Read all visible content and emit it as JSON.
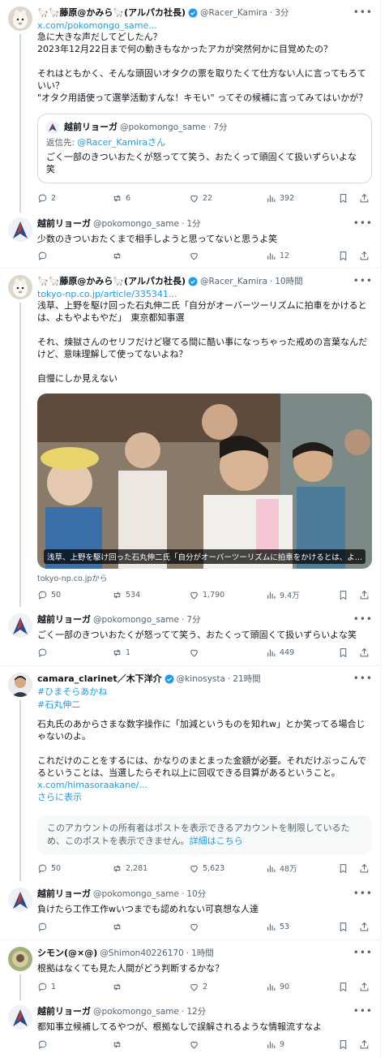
{
  "icons": {
    "reply": "reply-icon",
    "repost": "repost-icon",
    "like": "like-icon",
    "views": "views-icon",
    "bookmark": "bookmark-icon",
    "share": "share-icon",
    "more": "more-icon",
    "verified": "verified-badge-icon"
  },
  "colors": {
    "link": "#1d9bf0",
    "muted": "#536471",
    "verified": "#1d9bf0",
    "border": "#cfd9de"
  },
  "posts": [
    {
      "name": "🦙🦙藤原@かみら🦙(アルパカ社長)",
      "handle": "@Racer_Kamira",
      "time": "3分",
      "link": "x.com/pokomongo_same...",
      "text": "急に大きな声だしてどしたん？\n2023年12月22日まで何の動きもなかったアカが突然何かに目覚めたの？\n\nそれはともかく、そんな頭固いオタクの票を取りたくて仕方ない人に言ってもろていい？\n\"オタク用語使って選挙活動すんな！キモい\" ってその候補に言ってみてはいかが？",
      "quote": {
        "name": "越前リョーガ",
        "handle": "@pokomongo_same",
        "time": "7分",
        "reply_to_prefix": "返信先: ",
        "reply_to": "@Racer_Kamiraさん",
        "text": "ごく一部のきついおたくが怒ってて笑う、おたくって頭固くて扱いずらいよな笑"
      },
      "replies": "2",
      "reposts": "6",
      "likes": "22",
      "views": "392"
    },
    {
      "name": "越前リョーガ",
      "handle": "@pokomongo_same",
      "time": "1分",
      "text": "少数のきついおたくまで相手しようと思ってないと思うよ笑",
      "replies": "",
      "reposts": "",
      "likes": "",
      "views": "12"
    },
    {
      "name": "🦙🦙藤原@かみら🦙(アルパカ社長)",
      "handle": "@Racer_Kamira",
      "time": "10時間",
      "link": "tokyo-np.co.jp/article/335341...",
      "text": "浅草、上野を駆け回った石丸伸二氏「自分がオーバーツーリズムに拍車をかけるとは、よもやよもやだ」　東京都知事選\n\nそれ、煉獄さんのセリフだけど寝てる間に酷い事になっちゃった戒めの言葉なんだけど、意味理解して使ってないよね？\n\n自慢にしか見えない",
      "photo_caption": "浅草、上野を駆け回った石丸伸二氏「自分がオーバーツーリズムに拍車をかけるとは、よ…",
      "source": "tokyo-np.co.jpから",
      "replies": "50",
      "reposts": "534",
      "likes": "1,790",
      "views": "9.4万"
    },
    {
      "name": "越前リョーガ",
      "handle": "@pokomongo_same",
      "time": "7分",
      "text": "ごく一部のきついおたくが怒ってて笑う、おたくって頭固くて扱いずらいよな笑",
      "replies": "",
      "reposts": "1",
      "likes": "",
      "views": "449"
    },
    {
      "name": "camara_clarinet／木下洋介",
      "handle": "@kinosysta",
      "time": "21時間",
      "hashtag1": "#ひまそらあかね",
      "hashtag2": "#石丸伸二",
      "text": "石丸氏のあからさまな数字操作に「加減というものを知れw」とか笑ってる場合じゃないのよ。\n\nこれだけのことをするには、かなりのまとまった金額が必要。それだけぶっこんでるということは、当選したらそれ以上に回収できる目算があるということ。",
      "link": "x.com/himasoraakane/...",
      "show_more": "さらに表示",
      "notice": "このアカウントの所有者はポストを表示できるアカウントを制限しているため、このポストを表示できません。",
      "notice_link": "詳細はこちら",
      "replies": "50",
      "reposts": "2,281",
      "likes": "5,623",
      "views": "48万"
    },
    {
      "name": "越前リョーガ",
      "handle": "@pokomongo_same",
      "time": "10分",
      "text": "負けたら工作工作wいつまでも認めれない可哀想な人達",
      "replies": "",
      "reposts": "",
      "likes": "",
      "views": "53"
    },
    {
      "name": "シモン(@×@)",
      "handle": "@Shimon40226170",
      "time": "1時間",
      "text": "根拠はなくても見た人間がどう判断するかな？",
      "replies": "1",
      "reposts": "",
      "likes": "2",
      "views": "90"
    },
    {
      "name": "越前リョーガ",
      "handle": "@pokomongo_same",
      "time": "12分",
      "text": "都知事立候補してるやつが、根拠なしで誤解されるような情報流すなよ",
      "replies": "",
      "reposts": "",
      "likes": "",
      "views": "9"
    }
  ]
}
